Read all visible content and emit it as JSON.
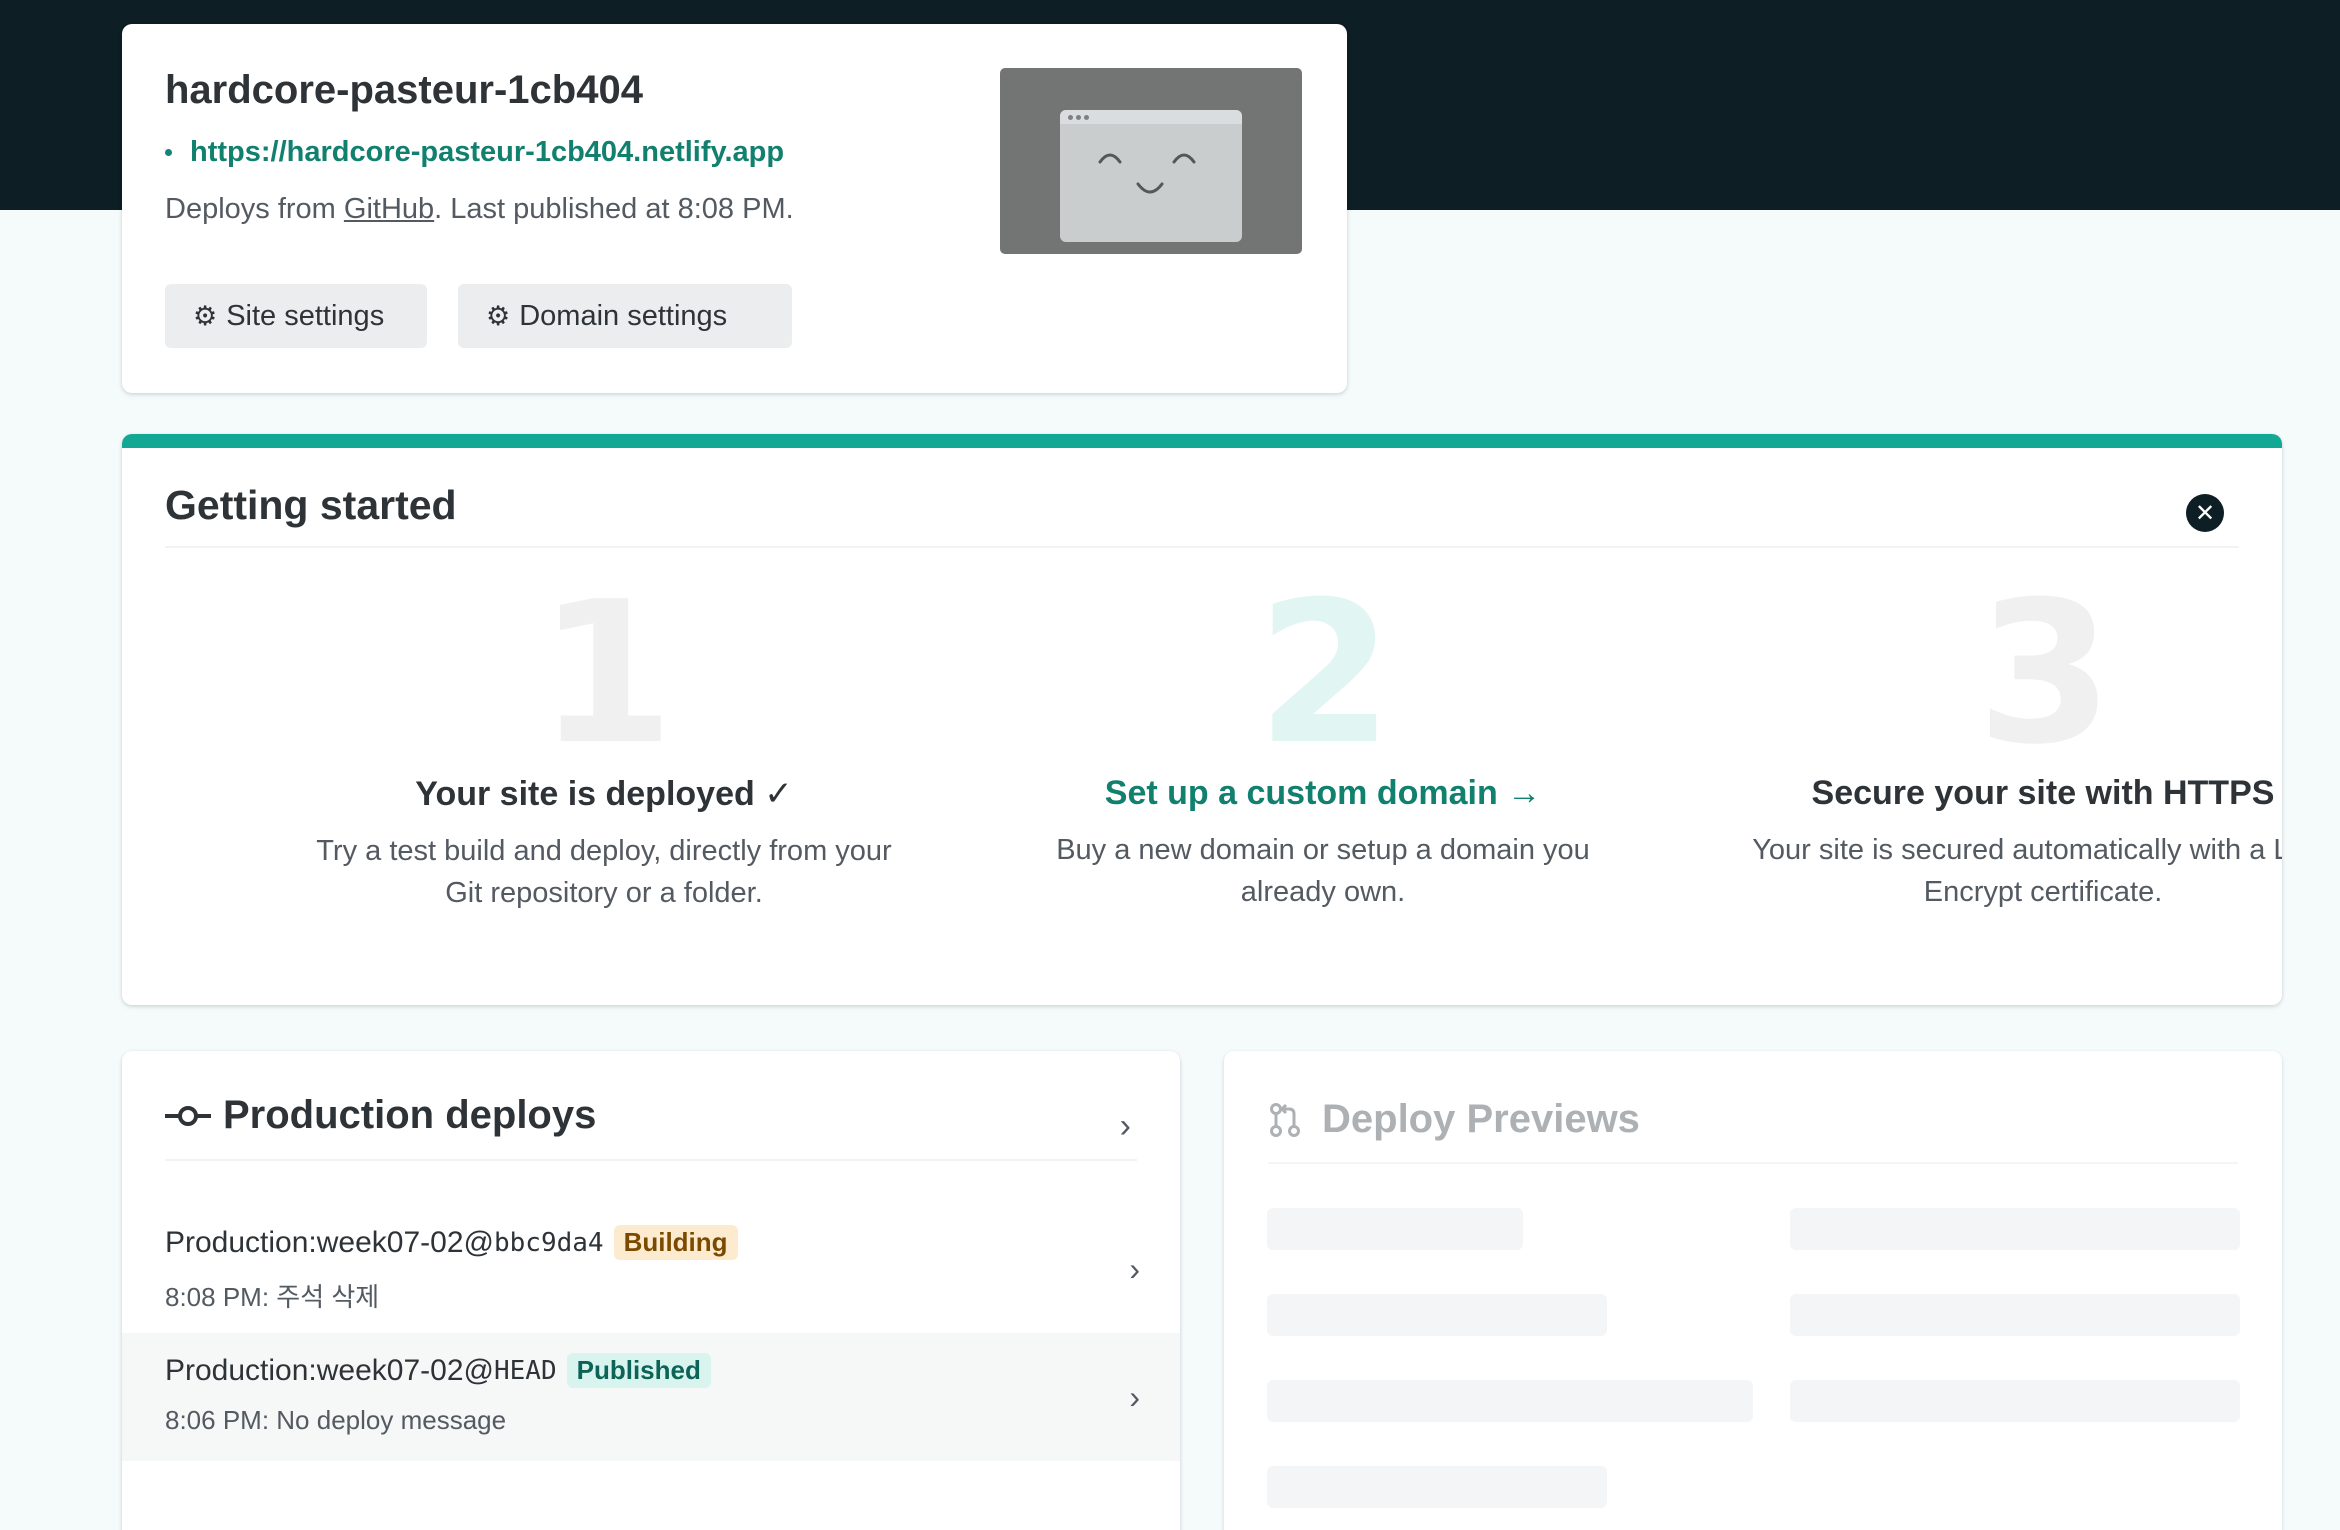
{
  "site": {
    "name": "hardcore-pasteur-1cb404",
    "url": "https://hardcore-pasteur-1cb404.netlify.app",
    "meta_prefix": "Deploys from ",
    "meta_link": "GitHub",
    "meta_suffix": ". Last published at 8:08 PM.",
    "buttons": {
      "site_settings": "Site settings",
      "domain_settings": "Domain settings"
    }
  },
  "getting_started": {
    "title": "Getting started",
    "steps": [
      {
        "number": "1",
        "title": "Your site is deployed ✓",
        "desc_line1": "Try a test build and deploy, directly from your",
        "desc_line2": "Git repository or a folder."
      },
      {
        "number": "2",
        "title": "Set up a custom domain →",
        "desc_line1": "Buy a new domain or setup a domain you",
        "desc_line2": "already own."
      },
      {
        "number": "3",
        "title": "Secure your site with HTTPS",
        "desc_line1": "Your site is secured automatically with a Let's",
        "desc_line2": "Encrypt certificate."
      }
    ]
  },
  "production_deploys": {
    "title": "Production deploys",
    "rows": [
      {
        "context": "Production: ",
        "branch": "week07-02@",
        "ref": "bbc9da4",
        "status": "Building",
        "time": "8:08 PM: ",
        "message": "주석 삭제"
      },
      {
        "context": "Production: ",
        "branch": "week07-02@",
        "ref": "HEAD",
        "status": "Published",
        "time": "8:06 PM: ",
        "message": "No deploy message"
      }
    ]
  },
  "deploy_previews": {
    "title": "Deploy Previews"
  },
  "colors": {
    "topbar": "#0e1e25",
    "accent": "#12a893",
    "link": "#12806f",
    "building_badge": "#fdebcf",
    "published_badge": "#d9f4ef"
  }
}
